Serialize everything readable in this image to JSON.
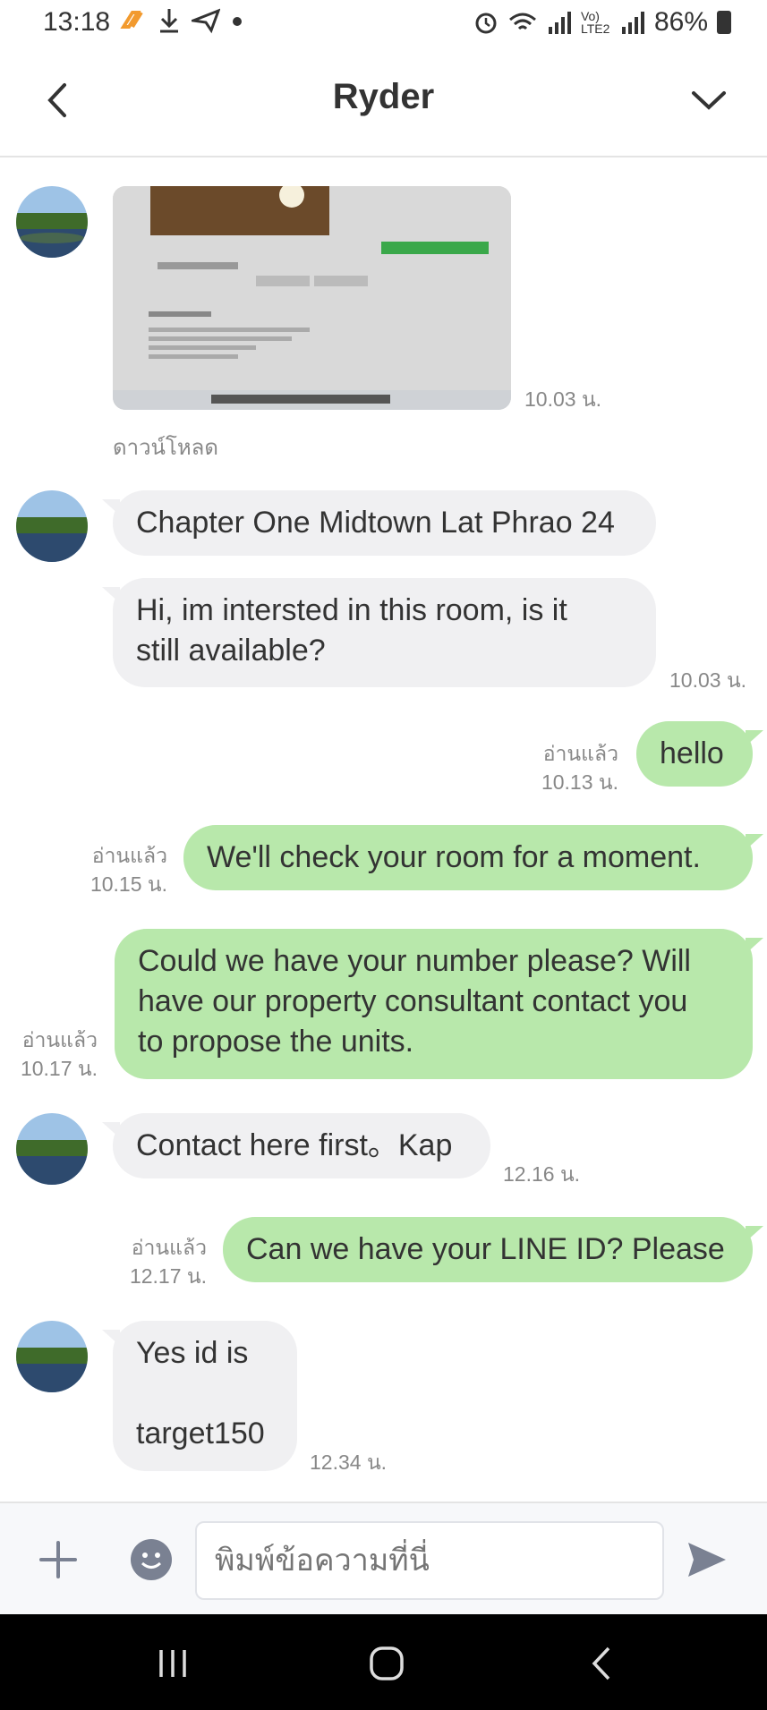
{
  "status_bar": {
    "time": "13:18",
    "battery": "86%",
    "network": "Vo) LTE2"
  },
  "header": {
    "title": "Ryder"
  },
  "messages": [
    {
      "type": "image",
      "direction": "in",
      "time": "10.03 น.",
      "download_label": "ดาวน์โหลด"
    },
    {
      "type": "text",
      "direction": "in",
      "text": "Chapter One Midtown Lat Phrao 24"
    },
    {
      "type": "text",
      "direction": "in",
      "text_line1": "Hi, im intersted in this room, is it",
      "text_line2": "still available?",
      "time": "10.03 น."
    },
    {
      "type": "text",
      "direction": "out",
      "text": "hello",
      "read": "อ่านแล้ว",
      "time": "10.13 น."
    },
    {
      "type": "text",
      "direction": "out",
      "text": "We'll check your room for a moment.",
      "read": "อ่านแล้ว",
      "time": "10.15 น."
    },
    {
      "type": "text",
      "direction": "out",
      "text_line1": "Could we have your number please? Will",
      "text_line2": "have our property consultant contact you",
      "text_line3": "to propose the units.",
      "read": "อ่านแล้ว",
      "time": "10.17 น."
    },
    {
      "type": "text",
      "direction": "in",
      "text": "Contact here first。Kap",
      "time": "12.16 น."
    },
    {
      "type": "text",
      "direction": "out",
      "text": "Can we have your LINE ID? Please",
      "read": "อ่านแล้ว",
      "time": "12.17 น."
    },
    {
      "type": "text",
      "direction": "in",
      "text_line1": "Yes id is",
      "text_line2": "target150",
      "time": "12.34 น."
    }
  ],
  "input": {
    "placeholder": "พิมพ์ข้อความที่นี่"
  },
  "colors": {
    "outgoing_bubble": "#b8e8ab",
    "incoming_bubble": "#f0f0f2",
    "send_icon": "#7a8192"
  },
  "icons": [
    "back-arrow-icon",
    "chevron-down-icon",
    "plus-icon",
    "emoji-icon",
    "send-icon",
    "recent-apps-icon",
    "home-icon",
    "nav-back-icon"
  ]
}
